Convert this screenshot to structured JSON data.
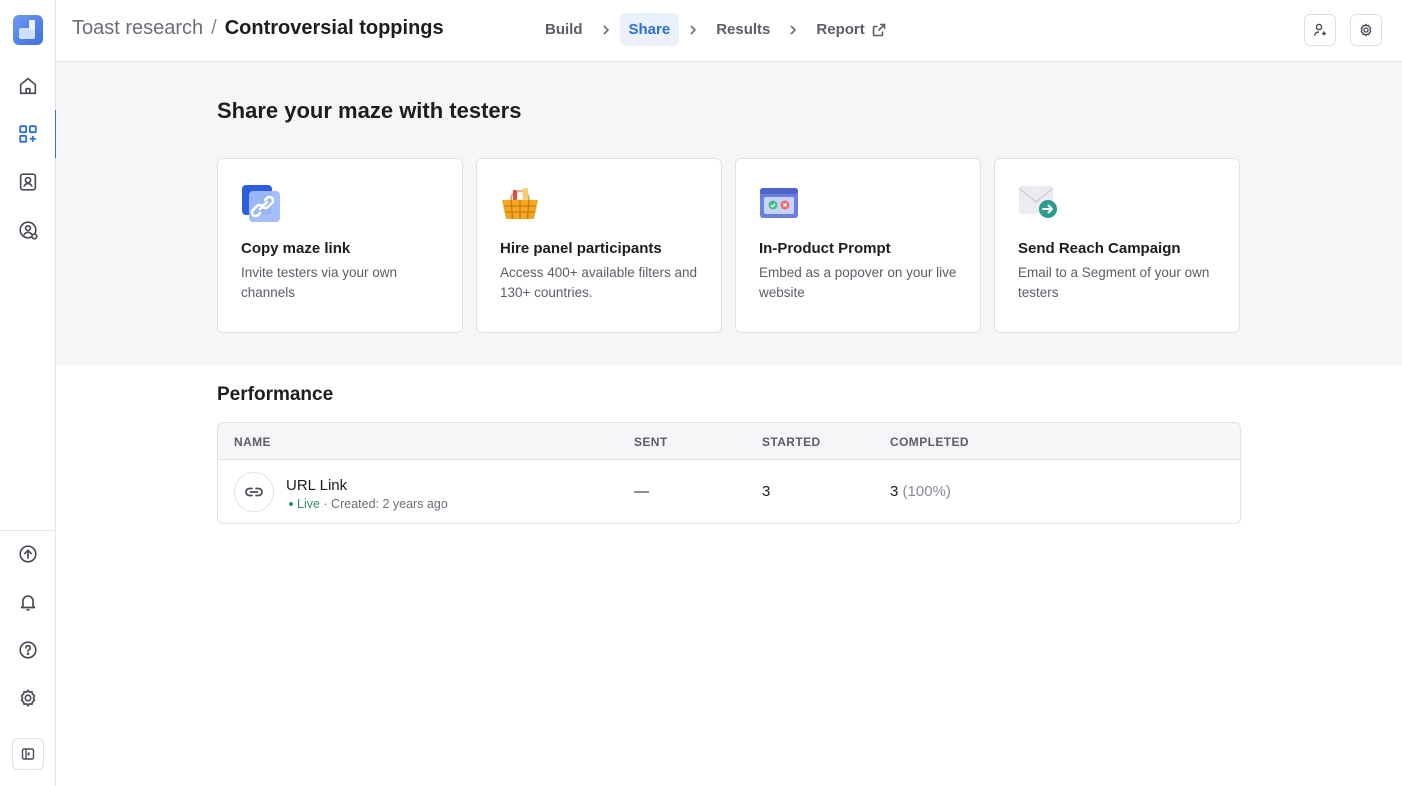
{
  "breadcrumb": {
    "parent": "Toast research",
    "separator": "/",
    "current": "Controversial toppings"
  },
  "steps": [
    {
      "label": "Build",
      "active": false
    },
    {
      "label": "Share",
      "active": true
    },
    {
      "label": "Results",
      "active": false
    },
    {
      "label": "Report",
      "active": false,
      "icon": "external-link-icon"
    }
  ],
  "header_actions": [
    {
      "name": "invite-user-icon"
    },
    {
      "name": "settings-icon"
    }
  ],
  "sidebar": {
    "top_items": [
      "home-icon",
      "mazes-icon",
      "contacts-icon",
      "participants-icon"
    ],
    "active_item": "mazes-icon",
    "bottom_items": [
      "upgrade-icon",
      "notifications-icon",
      "help-icon",
      "settings-icon"
    ]
  },
  "share": {
    "title": "Share your maze with testers",
    "cards": [
      {
        "title": "Copy maze link",
        "desc": "Invite testers via your own channels",
        "icon": "link-icon"
      },
      {
        "title": "Hire panel participants",
        "desc": "Access 400+ available filters and 130+ countries.",
        "icon": "basket-icon"
      },
      {
        "title": "In-Product Prompt",
        "desc": "Embed as a popover on your live website",
        "icon": "prompt-icon"
      },
      {
        "title": "Send Reach Campaign",
        "desc": "Email to a Segment of your own testers",
        "icon": "email-send-icon"
      }
    ]
  },
  "performance": {
    "title": "Performance",
    "columns": [
      "NAME",
      "SENT",
      "STARTED",
      "COMPLETED"
    ],
    "rows": [
      {
        "name": "URL Link",
        "status": "Live",
        "created": "Created: 2 years ago",
        "sent": "—",
        "started": "3",
        "completed": "3",
        "completed_pct": "(100%)"
      }
    ]
  },
  "colors": {
    "accent": "#2b6fd6",
    "live": "#2f8f67"
  }
}
